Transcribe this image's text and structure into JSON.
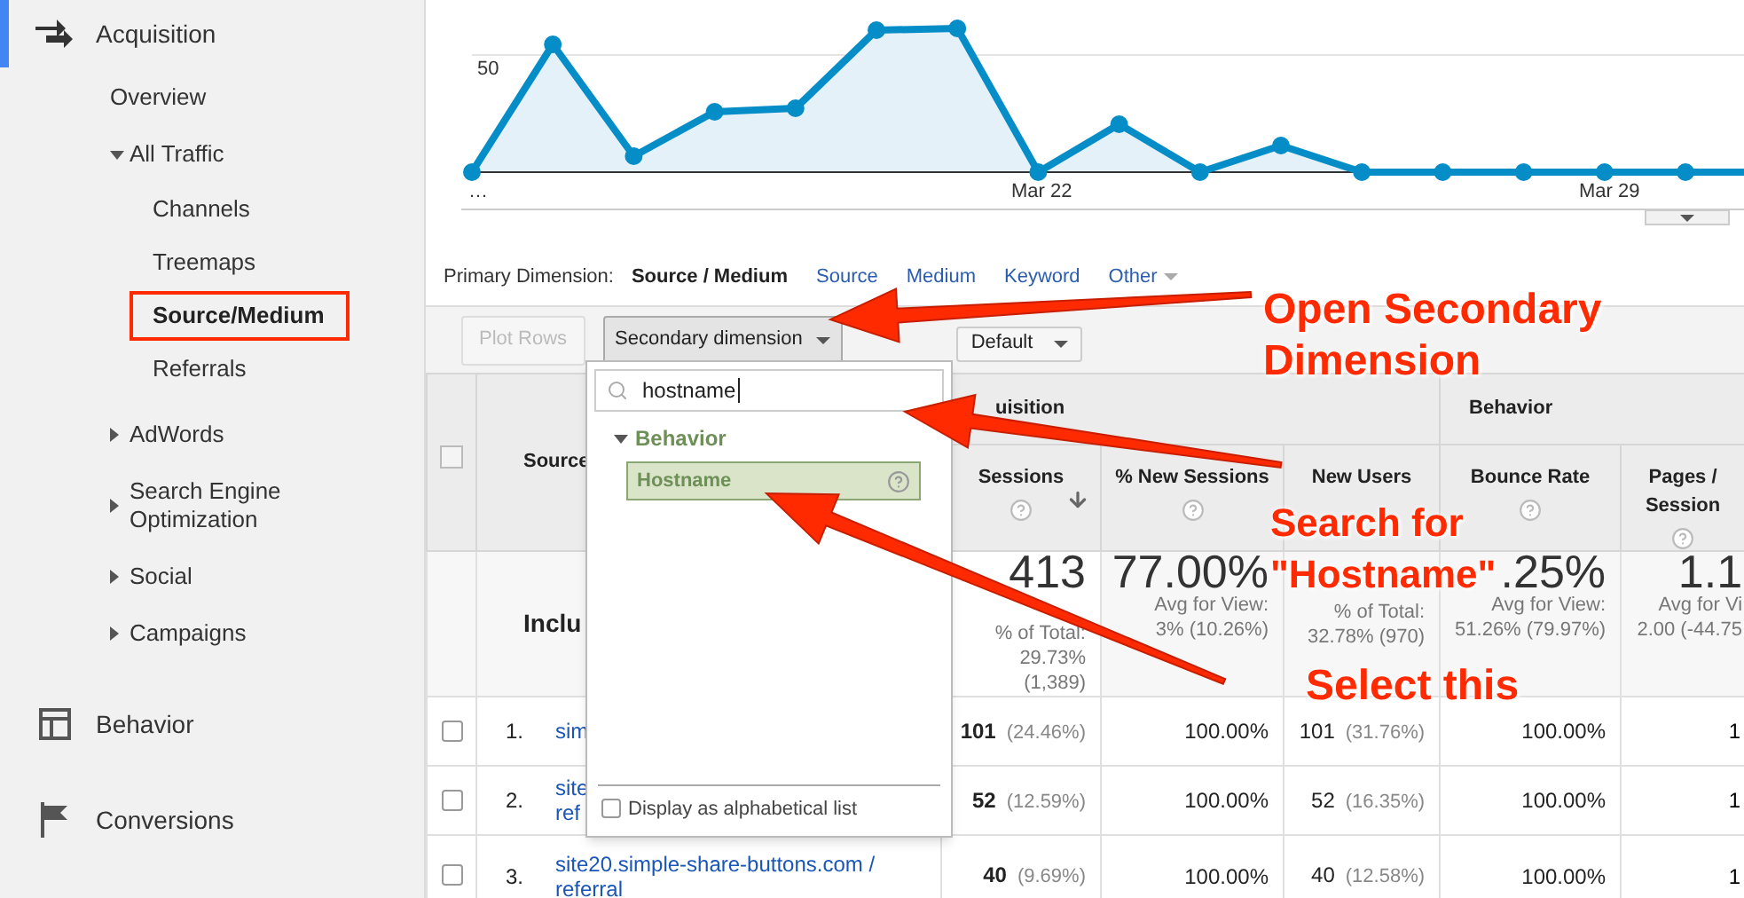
{
  "sidebar": {
    "items": [
      {
        "label": "Acquisition",
        "selected": true,
        "children": [
          {
            "label": "Overview",
            "selected": false
          },
          {
            "label": "All Traffic",
            "selected": false,
            "expanded": true,
            "children": [
              {
                "label": "Channels",
                "selected": false
              },
              {
                "label": "Treemaps",
                "selected": false
              },
              {
                "label": "Source/Medium",
                "selected": true
              },
              {
                "label": "Referrals",
                "selected": false
              }
            ]
          },
          {
            "label": "AdWords",
            "selected": false,
            "expanded": false
          },
          {
            "label": "Search Engine Optimization",
            "selected": false,
            "expanded": false
          },
          {
            "label": "Social",
            "selected": false,
            "expanded": false
          },
          {
            "label": "Campaigns",
            "selected": false,
            "expanded": false
          }
        ]
      },
      {
        "label": "Behavior",
        "selected": false
      },
      {
        "label": "Conversions",
        "selected": false
      }
    ]
  },
  "chart": {
    "y_ticks": [
      "50"
    ],
    "x_labels": [
      "…",
      "Mar 22",
      "Mar 29"
    ]
  },
  "primary_dimension": {
    "label": "Primary Dimension:",
    "options": [
      {
        "label": "Source / Medium",
        "selected": true,
        "menu": false
      },
      {
        "label": "Source",
        "selected": false,
        "menu": false
      },
      {
        "label": "Medium",
        "selected": false,
        "menu": false
      },
      {
        "label": "Keyword",
        "selected": false,
        "menu": false
      },
      {
        "label": "Other",
        "selected": false,
        "menu": true
      }
    ]
  },
  "toolbar": {
    "plot_rows": {
      "label": "Plot Rows",
      "disabled": true
    },
    "secondary_dimension": {
      "label": "Secondary dimension",
      "open": true
    },
    "sort_type": {
      "value": "Default"
    }
  },
  "secondary_menu": {
    "search": {
      "value": "hostname"
    },
    "groups": [
      {
        "label": "Behavior",
        "expanded": true,
        "items": [
          {
            "label": "Hostname",
            "selected": true
          }
        ]
      }
    ],
    "alphabetical": {
      "label": "Display as alphabetical list",
      "checked": false
    }
  },
  "table": {
    "select_all": {
      "checked": false
    },
    "source_header": {
      "label": "Source"
    },
    "group_headers": [
      "uisition",
      "Behavior"
    ],
    "columns": [
      {
        "label": "Sessions",
        "sorted": true,
        "help": true
      },
      {
        "label": "% New Sessions",
        "sorted": false,
        "help": true
      },
      {
        "label": "New Users",
        "sorted": false,
        "help": false
      },
      {
        "label": "Bounce Rate",
        "sorted": false,
        "help": true
      },
      {
        "label": "Pages / Session",
        "sorted": false,
        "help": true
      }
    ],
    "totals": {
      "label": "Inclu",
      "cells": [
        {
          "value": "413",
          "lines": [
            "% of Total:",
            "29.73%",
            "(1,389)"
          ]
        },
        {
          "value": "77.00%",
          "lines": [
            "Avg for View:",
            "3% (10.26%)"
          ]
        },
        {
          "lines": [
            "% of Total:",
            "32.78% (970)"
          ]
        },
        {
          "value": ".25%",
          "lines": [
            "Avg for View:",
            "51.26% (79.97%)"
          ]
        },
        {
          "value": "1.1",
          "lines": [
            "Avg for Vi",
            "2.00 (-44.75"
          ]
        }
      ]
    },
    "rows": [
      {
        "checked": false,
        "index": "1.",
        "source": [
          "sim"
        ],
        "cells": [
          {
            "value": "101",
            "share": "(24.46%)"
          },
          {
            "value": "100.00%"
          },
          {
            "value": "101",
            "share": "(31.76%)"
          },
          {
            "value": "100.00%"
          },
          {
            "value": "1"
          }
        ]
      },
      {
        "checked": false,
        "index": "2.",
        "source": [
          "site",
          "ref"
        ],
        "cells": [
          {
            "value": "52",
            "share": "(12.59%)"
          },
          {
            "value": "100.00%"
          },
          {
            "value": "52",
            "share": "(16.35%)"
          },
          {
            "value": "100.00%"
          },
          {
            "value": "1"
          }
        ]
      },
      {
        "checked": false,
        "index": "3.",
        "source": [
          "site20.simple-share-buttons.com /",
          "referral"
        ],
        "cells": [
          {
            "value": "40",
            "share": "(9.69%)"
          },
          {
            "value": "100.00%"
          },
          {
            "value": "40",
            "share": "(12.58%)"
          },
          {
            "value": "100.00%"
          },
          {
            "value": "1"
          }
        ]
      }
    ]
  },
  "annotations": [
    {
      "text": "Open Secondary Dimension"
    },
    {
      "text": "Search for \"Hostname\""
    },
    {
      "text": "Select this"
    }
  ]
}
